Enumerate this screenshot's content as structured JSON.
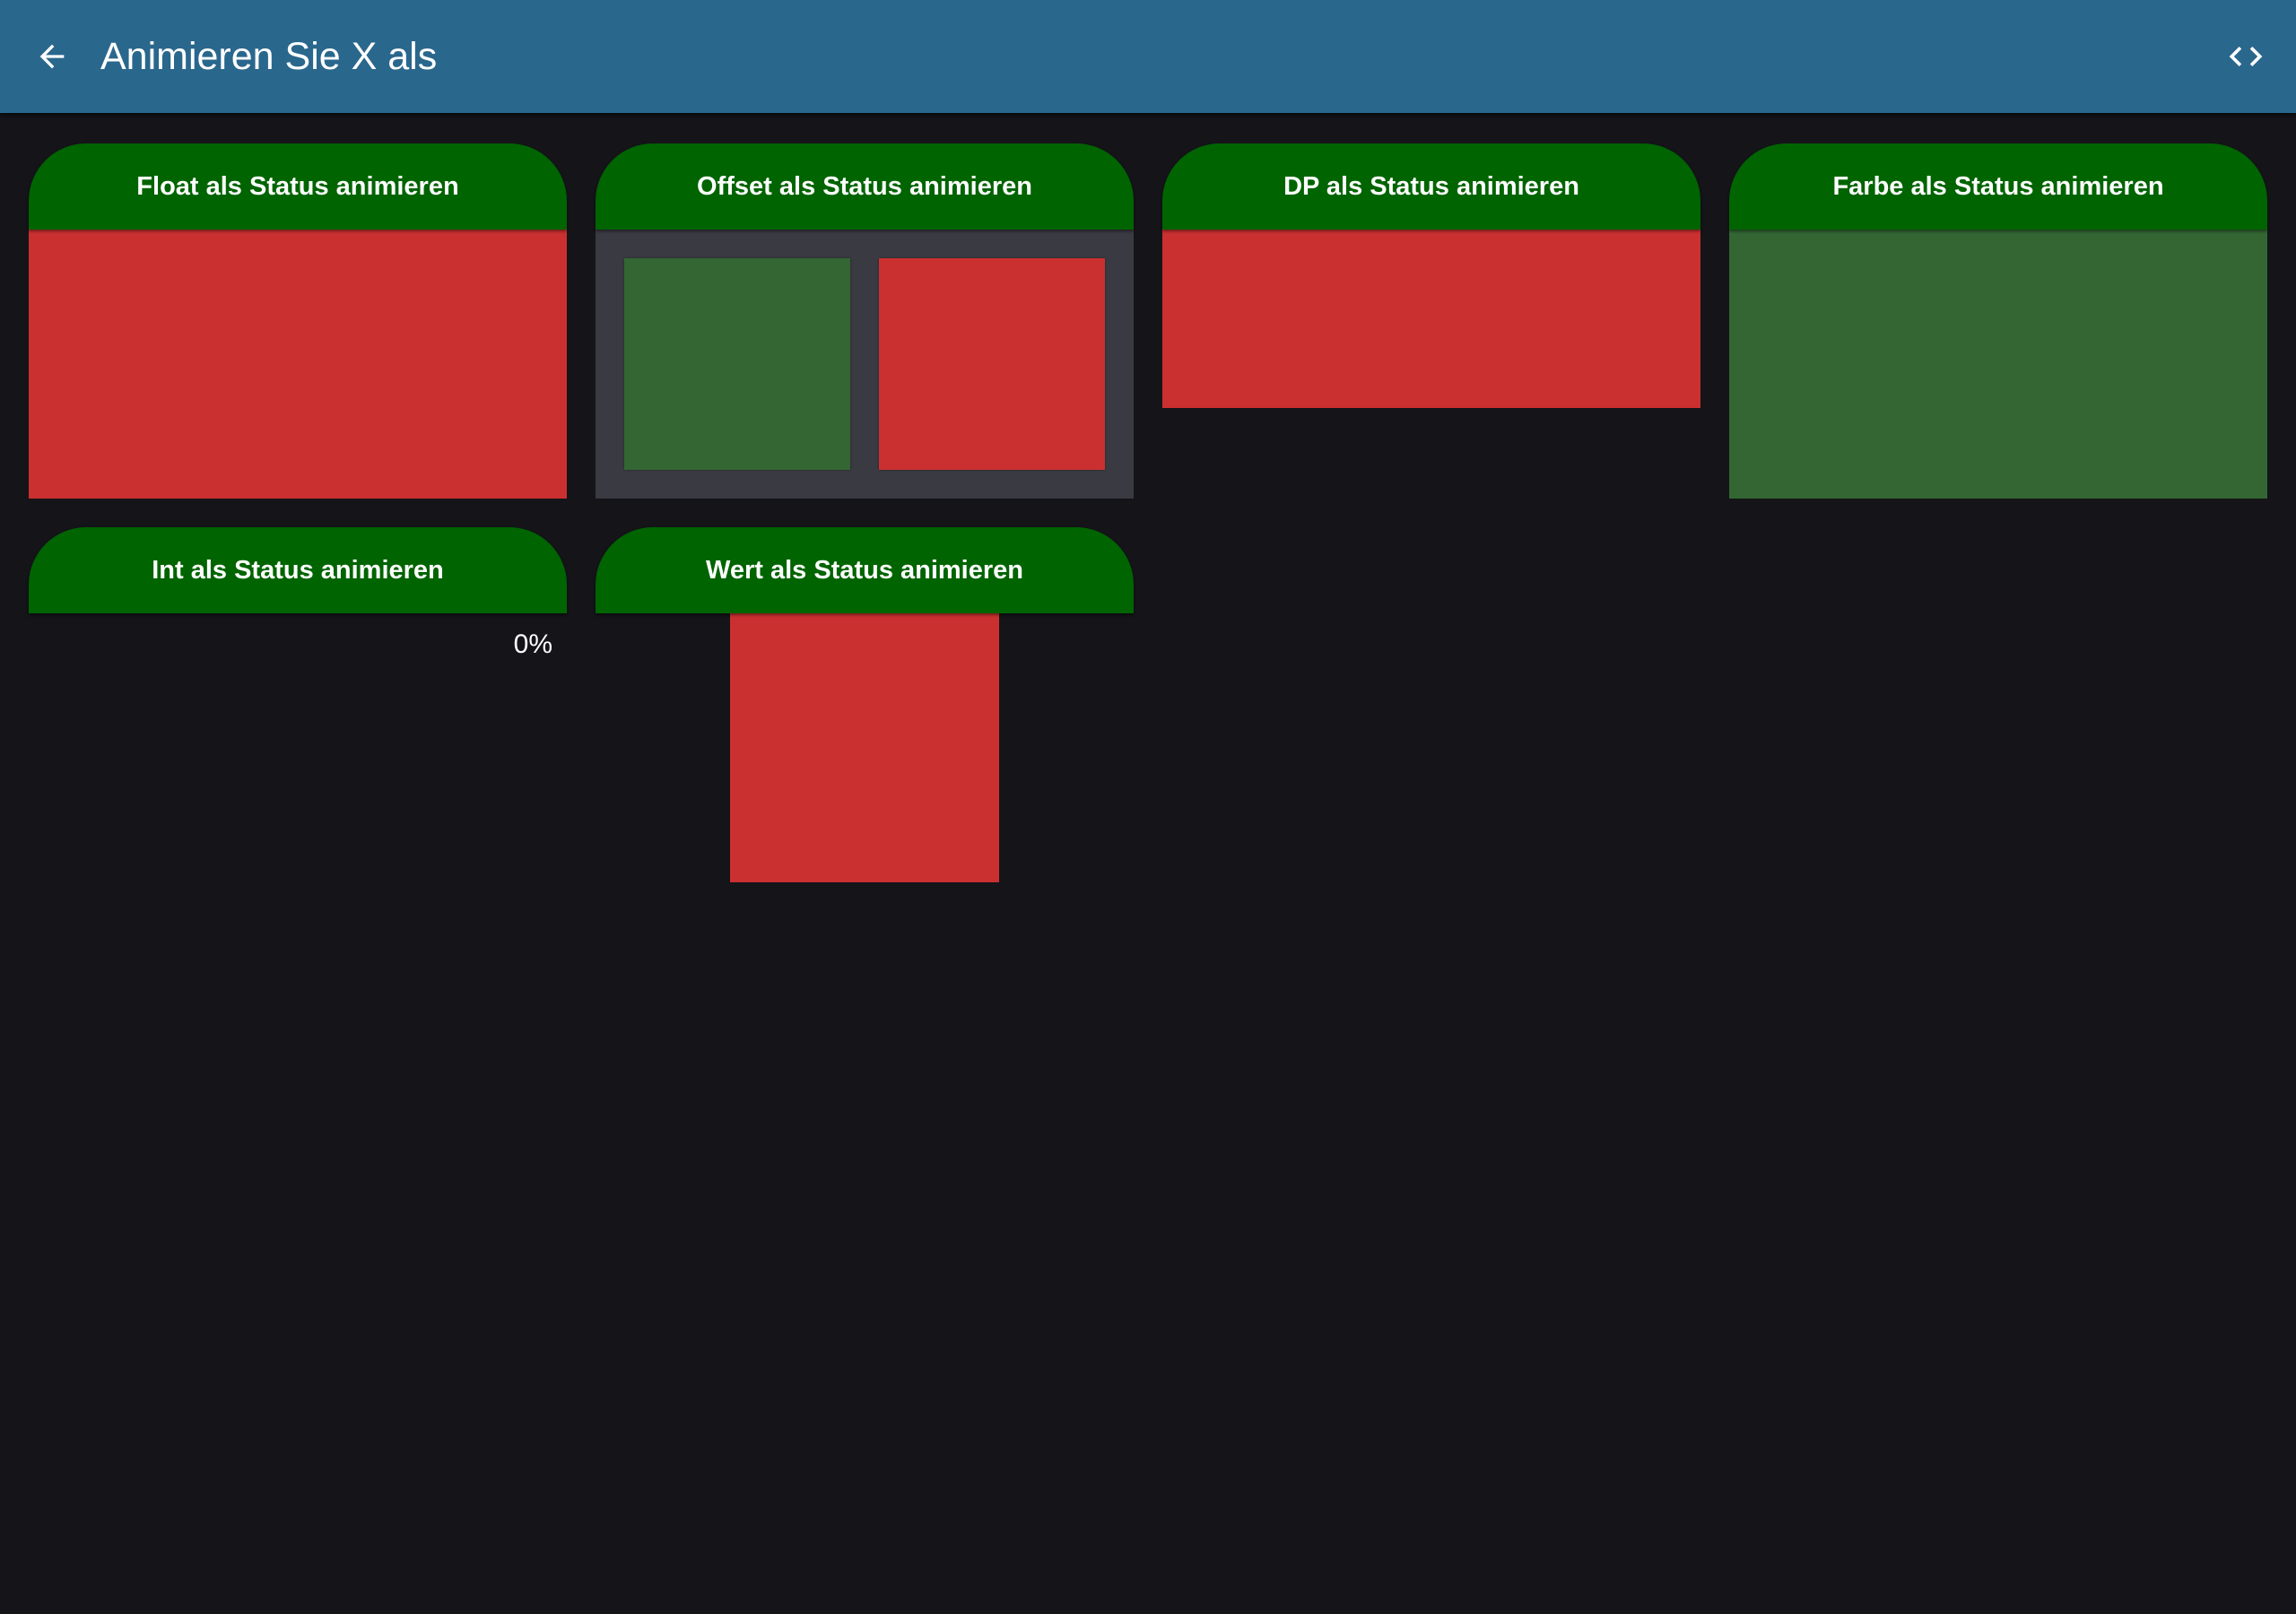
{
  "header": {
    "title": "Animieren Sie X als",
    "back_icon": "arrow-left-icon",
    "code_icon": "code-brackets-icon",
    "color": "#2a678d"
  },
  "colors": {
    "background": "#141419",
    "card_header": "#006400",
    "red": "#cb3030",
    "green": "#336633",
    "offset_panel": "#3a3a42"
  },
  "cards": [
    {
      "title": "Float als Status animieren"
    },
    {
      "title": "Offset als Status animieren"
    },
    {
      "title": "DP als Status animieren"
    },
    {
      "title": "Farbe als Status animieren"
    },
    {
      "title": "Int als Status animieren",
      "value": "0%"
    },
    {
      "title": "Wert als Status animieren"
    }
  ]
}
